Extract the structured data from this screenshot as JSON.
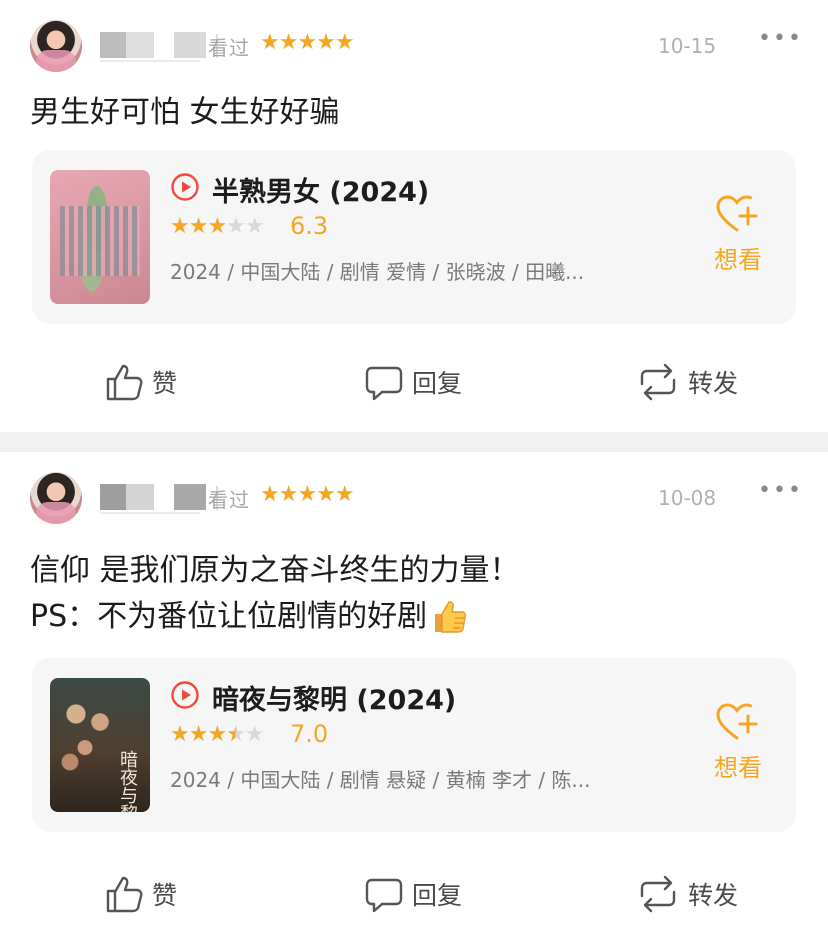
{
  "posts": [
    {
      "user": {
        "watched_label": "看过",
        "stars": "★★★★★",
        "date": "10-15"
      },
      "more": "•••",
      "content_lines": [
        "男生好可怕 女生好好骗"
      ],
      "movie": {
        "title": "半熟男女 (2024)",
        "score": "6.3",
        "stars_on": "★★★",
        "stars_off": "★★",
        "meta": "2024 / 中国大陆 / 剧情 爱情 / 张晓波 / 田曦...",
        "want_label": "想看"
      },
      "actions": {
        "like": "赞",
        "reply": "回复",
        "share": "转发"
      }
    },
    {
      "user": {
        "watched_label": "看过",
        "stars": "★★★★★",
        "date": "10-08"
      },
      "more": "•••",
      "content_lines": [
        "信仰 是我们原为之奋斗终生的力量！",
        "PS：不为番位让位剧情的好剧"
      ],
      "movie": {
        "title": "暗夜与黎明 (2024)",
        "score": "7.0",
        "stars_on": "★★★",
        "stars_half": "★",
        "stars_off": "★",
        "meta": "2024 / 中国大陆 / 剧情 悬疑 / 黄楠 李才 / 陈...",
        "poster_text": "暗夜与黎明",
        "want_label": "想看"
      },
      "actions": {
        "like": "赞",
        "reply": "回复",
        "share": "转发"
      }
    }
  ],
  "colors": {
    "accent": "#f5a623",
    "muted": "#a7a7a7",
    "card_bg": "#f6f6f6",
    "divider": "#f1f1f1"
  },
  "icons": [
    "play-circle-icon",
    "heart-plus-icon",
    "thumbs-up-icon",
    "comment-icon",
    "repost-icon",
    "thumbs-up-emoji-icon",
    "more-dots-icon"
  ]
}
